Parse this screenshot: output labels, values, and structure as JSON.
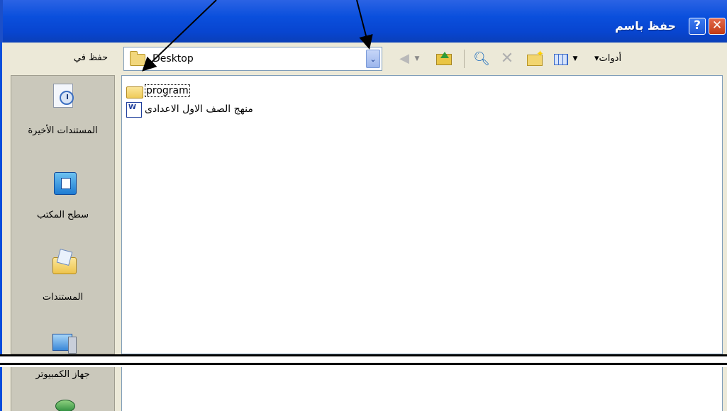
{
  "window": {
    "title": "حفظ باسم",
    "help_glyph": "?",
    "close_glyph": "✕"
  },
  "location_bar": {
    "label": "حفظ في",
    "current_folder": "Desktop",
    "dropdown_glyph": "⌄"
  },
  "toolbar": {
    "back_glyph": "◀",
    "tools_label": "▾أدوات"
  },
  "places": [
    {
      "label": "المستندات الأخيرة",
      "icon": "recent-documents-icon"
    },
    {
      "label": "سطح المكتب",
      "icon": "desktop-icon"
    },
    {
      "label": "المستندات",
      "icon": "my-documents-icon"
    },
    {
      "label": "جهاز الكمبيوتر",
      "icon": "my-computer-icon"
    },
    {
      "label": "",
      "icon": "network-places-icon"
    }
  ],
  "files": [
    {
      "name": "program",
      "type": "folder"
    },
    {
      "name": "منهج الصف الاول الاعدادى",
      "type": "word-document"
    }
  ],
  "word_icon_letter": "W",
  "colors": {
    "title_bar": "#0a4fdc",
    "dialog_bg": "#ece9d8",
    "places_bg": "#cac8bb"
  }
}
